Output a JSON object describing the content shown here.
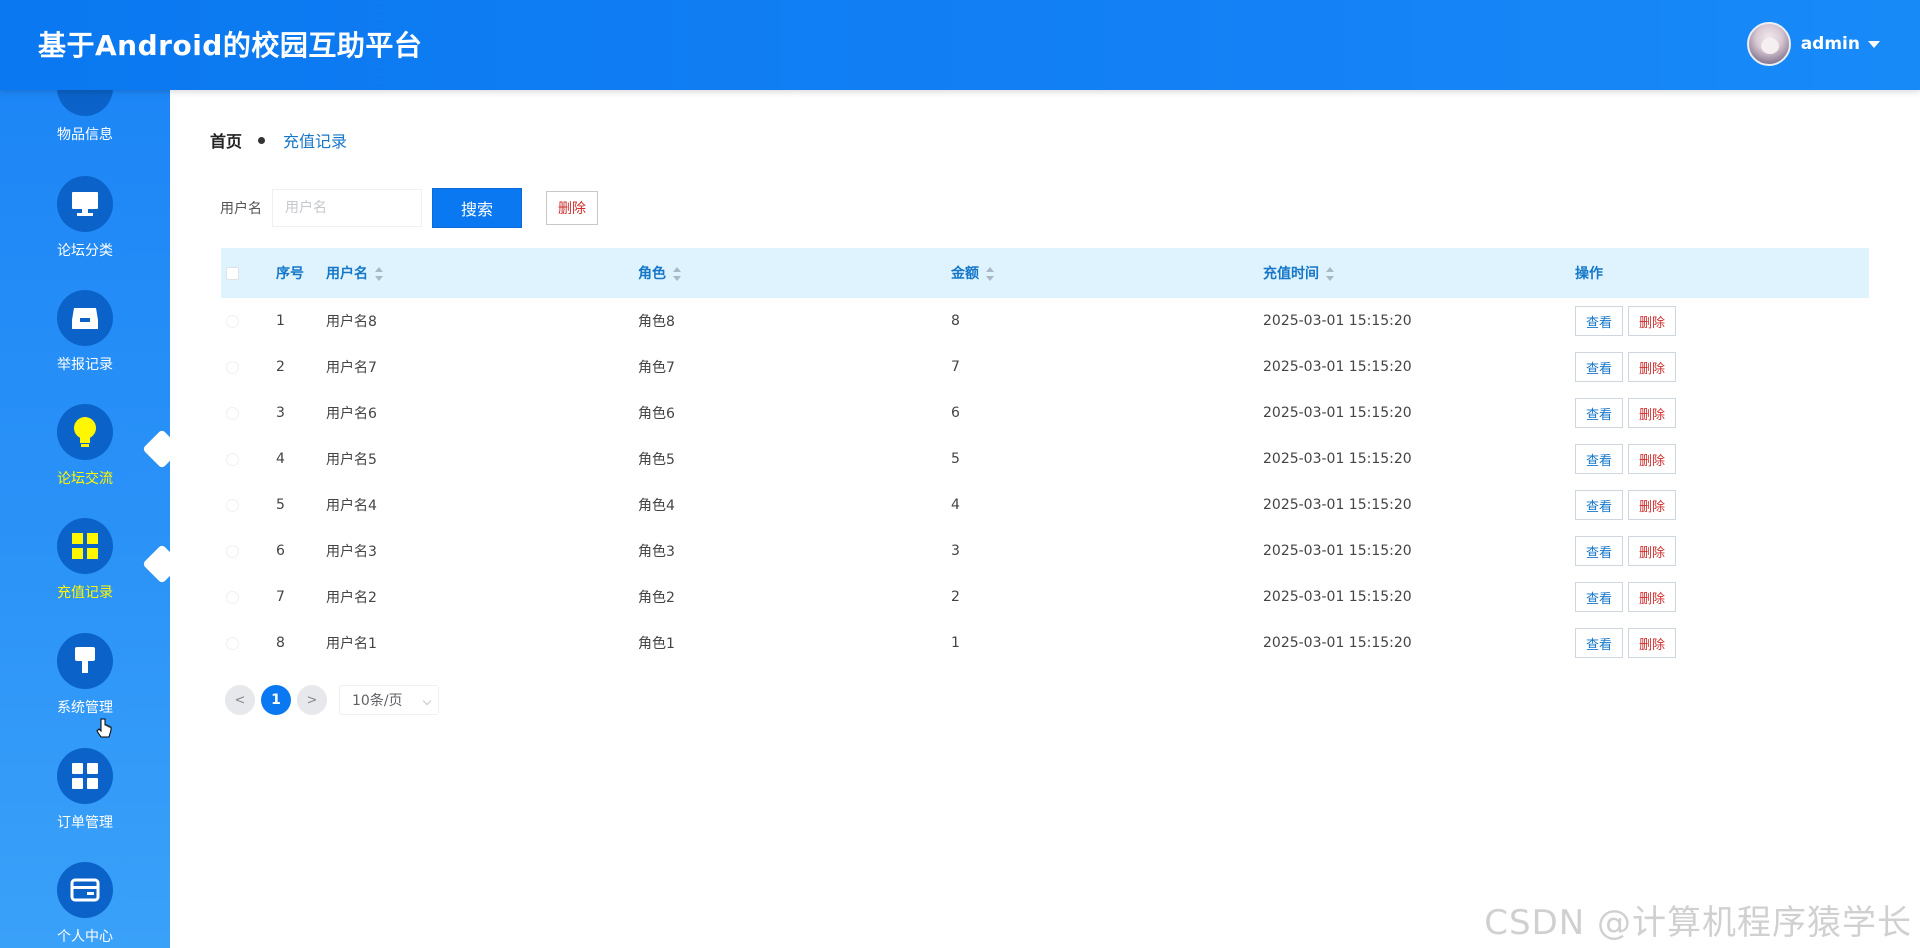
{
  "header": {
    "title": "基于Android的校园互助平台",
    "username": "admin"
  },
  "sidebar": {
    "items": [
      {
        "label": "物品信息",
        "icon": "box-icon"
      },
      {
        "label": "论坛分类",
        "icon": "monitor-icon"
      },
      {
        "label": "举报记录",
        "icon": "inbox-icon"
      },
      {
        "label": "论坛交流",
        "icon": "lightbulb-icon"
      },
      {
        "label": "充值记录",
        "icon": "grid-icon",
        "active": true
      },
      {
        "label": "系统管理",
        "icon": "brush-icon"
      },
      {
        "label": "订单管理",
        "icon": "grid-icon"
      },
      {
        "label": "个人中心",
        "icon": "card-icon"
      }
    ]
  },
  "breadcrumb": {
    "home": "首页",
    "current": "充值记录"
  },
  "search": {
    "label": "用户名",
    "placeholder": "用户名",
    "value": "",
    "search_button": "搜索",
    "delete_button": "删除"
  },
  "table": {
    "headers": {
      "index": "序号",
      "username": "用户名",
      "role": "角色",
      "amount": "金额",
      "time": "充值时间",
      "ops": "操作"
    },
    "view_label": "查看",
    "delete_label": "删除",
    "rows": [
      {
        "index": "1",
        "username": "用户名8",
        "role": "角色8",
        "amount": "8",
        "time": "2025-03-01 15:15:20"
      },
      {
        "index": "2",
        "username": "用户名7",
        "role": "角色7",
        "amount": "7",
        "time": "2025-03-01 15:15:20"
      },
      {
        "index": "3",
        "username": "用户名6",
        "role": "角色6",
        "amount": "6",
        "time": "2025-03-01 15:15:20"
      },
      {
        "index": "4",
        "username": "用户名5",
        "role": "角色5",
        "amount": "5",
        "time": "2025-03-01 15:15:20"
      },
      {
        "index": "5",
        "username": "用户名4",
        "role": "角色4",
        "amount": "4",
        "time": "2025-03-01 15:15:20"
      },
      {
        "index": "6",
        "username": "用户名3",
        "role": "角色3",
        "amount": "3",
        "time": "2025-03-01 15:15:20"
      },
      {
        "index": "7",
        "username": "用户名2",
        "role": "角色2",
        "amount": "2",
        "time": "2025-03-01 15:15:20"
      },
      {
        "index": "8",
        "username": "用户名1",
        "role": "角色1",
        "amount": "1",
        "time": "2025-03-01 15:15:20"
      }
    ]
  },
  "pagination": {
    "prev": "<",
    "current_page": "1",
    "next": ">",
    "page_size": "10条/页"
  },
  "watermark": "CSDN @计算机程序猿学长",
  "colors": {
    "header_bg": "#0a78f0",
    "sidebar_bg": "#2a92f7",
    "active_label": "#fff700",
    "link_blue": "#1677c9",
    "danger_red": "#d02c2c",
    "table_head_bg": "#dff3fe"
  }
}
